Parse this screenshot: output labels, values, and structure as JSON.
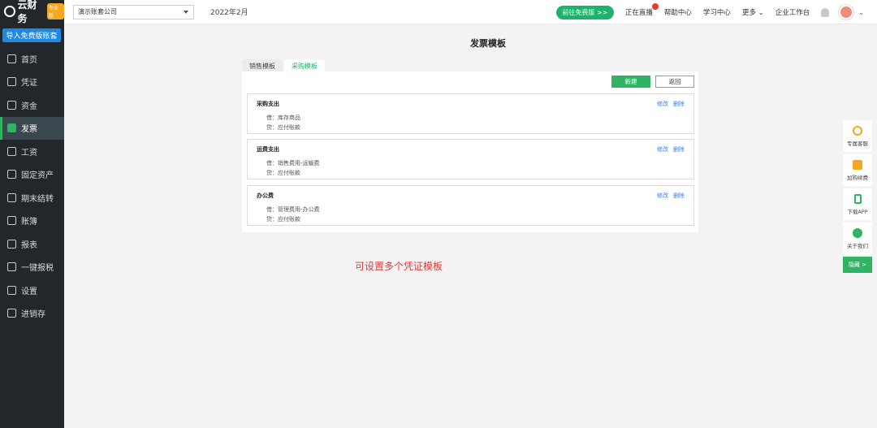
{
  "brand": {
    "name": "云财务",
    "tag": "专业版"
  },
  "sidebar": {
    "import_label": "导入免费版账套",
    "items": [
      {
        "label": "首页",
        "icon": "home-icon"
      },
      {
        "label": "凭证",
        "icon": "voucher-icon"
      },
      {
        "label": "资金",
        "icon": "fund-icon"
      },
      {
        "label": "发票",
        "icon": "invoice-icon",
        "active": true
      },
      {
        "label": "工资",
        "icon": "salary-icon"
      },
      {
        "label": "固定资产",
        "icon": "asset-icon"
      },
      {
        "label": "期末结转",
        "icon": "calendar-icon"
      },
      {
        "label": "账簿",
        "icon": "ledger-icon"
      },
      {
        "label": "报表",
        "icon": "chart-icon"
      },
      {
        "label": "一键报税",
        "icon": "tax-icon"
      },
      {
        "label": "设置",
        "icon": "gear-icon"
      },
      {
        "label": "进销存",
        "icon": "inventory-icon"
      }
    ]
  },
  "header": {
    "company": "演示账套公司",
    "period": "2022年2月",
    "free_button": "前往免费版 >>",
    "links": [
      "正在直播",
      "帮助中心",
      "学习中心",
      "更多",
      "企业工作台"
    ]
  },
  "page": {
    "title": "发票模板",
    "tabs": [
      "销售模板",
      "采购模板"
    ],
    "active_tab": 1,
    "new_label": "新建",
    "back_label": "返回",
    "templates": [
      {
        "name": "采购支出",
        "debit": "借：库存商品",
        "credit": "贷：应付账款"
      },
      {
        "name": "运费支出",
        "debit": "借：销售费用-运输费",
        "credit": "贷：应付账款"
      },
      {
        "name": "办公费",
        "debit": "借：管理费用-办公费",
        "credit": "贷：应付账款"
      }
    ],
    "edit_label": "修改",
    "delete_label": "删除",
    "annotation": "可设置多个凭证模板"
  },
  "float": {
    "items": [
      "专属客服",
      "加购续费",
      "下载APP",
      "关于我们"
    ],
    "hide_label": "隐藏 >"
  },
  "colors": {
    "accent": "#2fb463",
    "sidebar": "#22272b",
    "link": "#3a7be0",
    "annotation": "#e53935"
  }
}
